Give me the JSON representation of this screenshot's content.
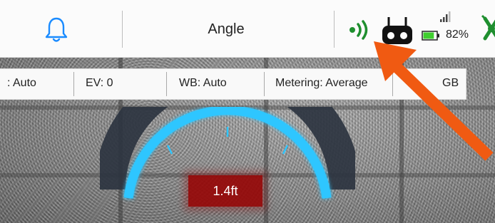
{
  "header": {
    "mode_title": "Angle",
    "battery_percent": "82%",
    "battery_level": 0.82,
    "icons": [
      "bell-icon",
      "signal-icon",
      "remote-controller-icon",
      "cellular-signal-icon",
      "battery-icon",
      "drone-icon"
    ]
  },
  "settings": {
    "iso": ": Auto",
    "ev": "EV:  0",
    "wb": "WB:  Auto",
    "metering": "Metering:  Average",
    "color_fragment": "GB"
  },
  "overlay": {
    "distance": "1.4ft"
  },
  "colors": {
    "accent_green": "#1f8f2f",
    "gauge_blue": "#2fc6ff",
    "badge_red": "#960808",
    "annotation_orange": "#f05a12"
  }
}
